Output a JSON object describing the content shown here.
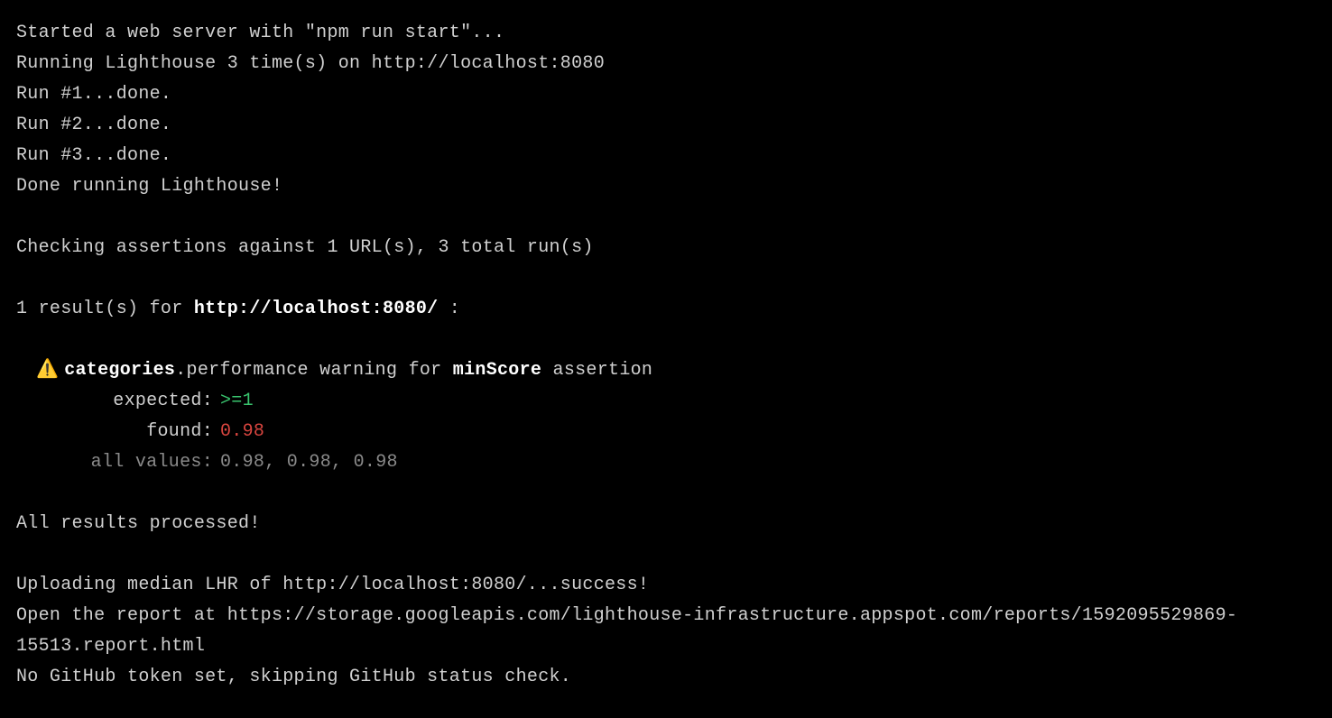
{
  "lines": {
    "started": "Started a web server with \"npm run start\"...",
    "running": "Running Lighthouse 3 time(s) on http://localhost:8080",
    "run1": "Run #1...done.",
    "run2": "Run #2...done.",
    "run3": "Run #3...done.",
    "done": "Done running Lighthouse!",
    "checking": "Checking assertions against 1 URL(s), 3 total run(s)",
    "results_prefix": "1 result(s) for ",
    "results_url": "http://localhost:8080/",
    "results_suffix": " :",
    "assertion_categories": "categories",
    "assertion_middle": ".performance warning for ",
    "assertion_minscore": "minScore",
    "assertion_suffix": " assertion",
    "expected_label": "expected:",
    "expected_value": ">=1",
    "found_label": "found:",
    "found_value": "0.98",
    "allvalues_label": "all values:",
    "allvalues_value": "0.98, 0.98, 0.98",
    "processed": "All results processed!",
    "uploading": "Uploading median LHR of http://localhost:8080/...success!",
    "open_report": "Open the report at https://storage.googleapis.com/lighthouse-infrastructure.appspot.com/reports/1592095529869-15513.report.html",
    "no_github": "No GitHub token set, skipping GitHub status check."
  }
}
